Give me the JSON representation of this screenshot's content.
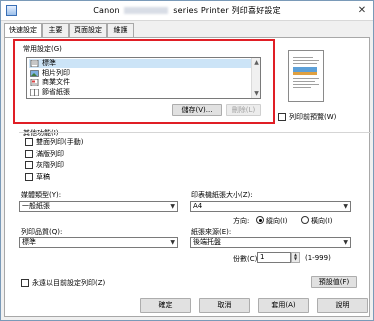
{
  "window": {
    "title_prefix": "Canon",
    "title_suffix": "series Printer 列印喜好設定",
    "close_glyph": "✕"
  },
  "tabs": [
    {
      "label": "快速設定"
    },
    {
      "label": "主要"
    },
    {
      "label": "頁面設定"
    },
    {
      "label": "維護"
    }
  ],
  "common_settings": {
    "label": "常用設定(G)",
    "items": [
      {
        "label": "標準",
        "icon": "standard-doc-icon"
      },
      {
        "label": "相片列印",
        "icon": "photo-icon"
      },
      {
        "label": "商業文件",
        "icon": "business-doc-icon"
      },
      {
        "label": "節省紙張",
        "icon": "paper-saving-icon"
      }
    ],
    "save_button": "儲存(V)...",
    "delete_button": "刪除(L)"
  },
  "preview_checkbox": "列印前預覽(W)",
  "additional": {
    "label": "其他功能(I)",
    "items": [
      {
        "label": "雙面列印(手動)"
      },
      {
        "label": "滿版列印"
      },
      {
        "label": "灰階列印"
      },
      {
        "label": "草稿"
      }
    ]
  },
  "media_type": {
    "label": "媒體類型(Y):",
    "value": "一般紙張"
  },
  "printer_paper_size": {
    "label": "印表機紙張大小(Z):",
    "value": "A4"
  },
  "orientation": {
    "label": "方向:",
    "portrait": "縱向(I)",
    "landscape": "橫向(I)"
  },
  "print_quality": {
    "label": "列印品質(Q):",
    "value": "標準"
  },
  "paper_source": {
    "label": "紙張來源(E):",
    "value": "後端托盤"
  },
  "copies": {
    "label": "份數(C):",
    "value": "1",
    "range": "(1-999)"
  },
  "always_print": "永遠以目前設定列印(Z)",
  "defaults_button": "預設值(F)",
  "footer": {
    "ok": "確定",
    "cancel": "取消",
    "apply": "套用(A)",
    "help": "說明"
  }
}
